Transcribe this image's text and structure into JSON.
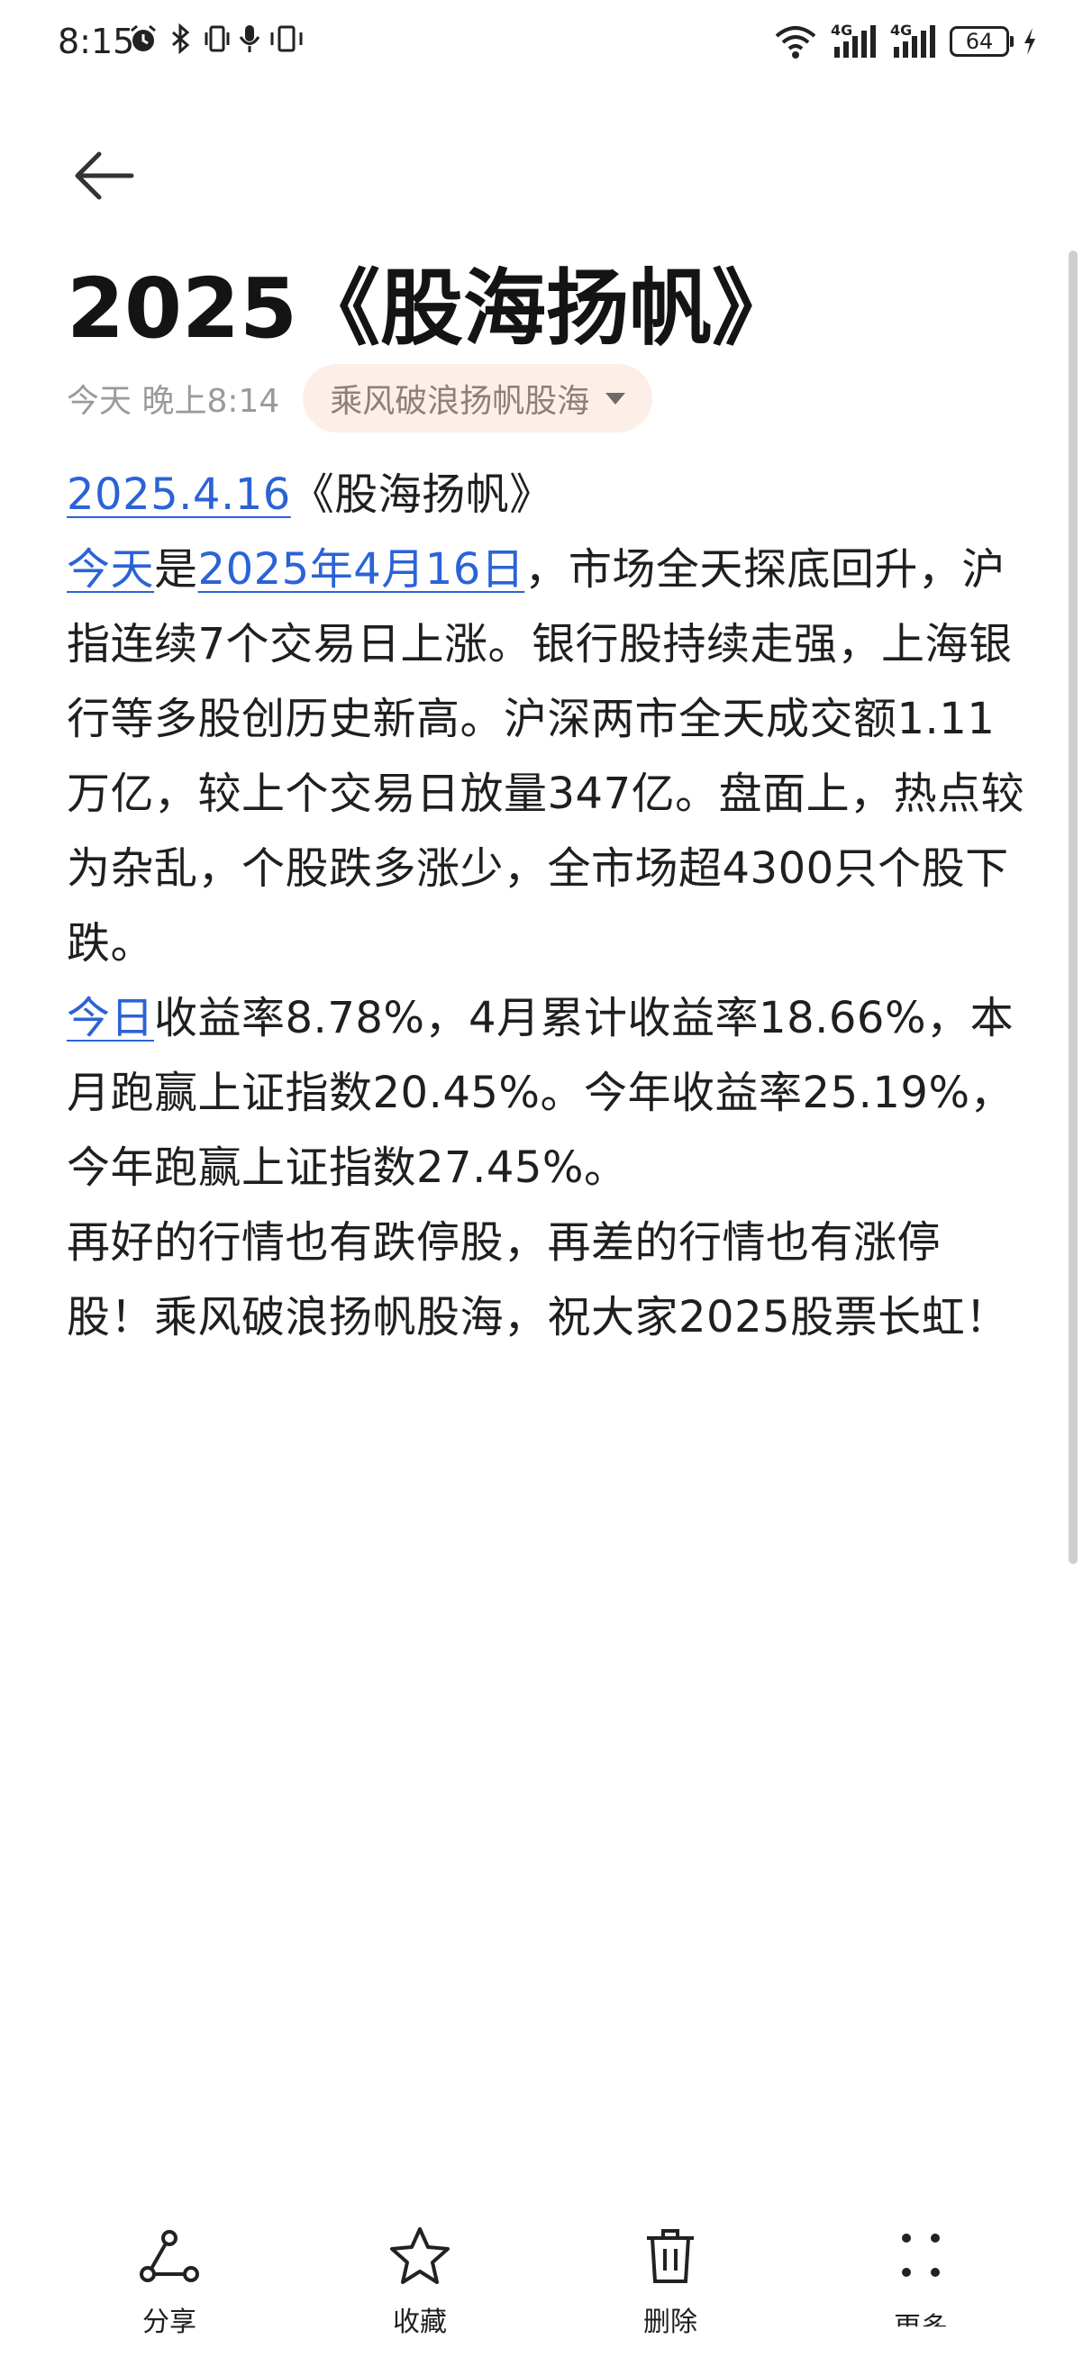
{
  "status_bar": {
    "time": "8:15",
    "battery": "64",
    "network_label_1": "4G",
    "network_label_2": "4G"
  },
  "note": {
    "title": "2025《股海扬帆》",
    "time": "今天 晚上8:14",
    "folder": "乘风破浪扬帆股海",
    "paragraphs": [
      {
        "link": "2025.4.16",
        "text": "《股海扬帆》"
      },
      {
        "link": "今天",
        "mid": "是",
        "link2": "2025年4月16日",
        "text": "，市场全天探底回升，沪指连续7个交易日上涨。银行股持续走强，上海银行等多股创历史新高。沪深两市全天成交额1.11万亿，较上个交易日放量347亿。盘面上，热点较为杂乱，个股跌多涨少，全市场超4300只个股下跌。"
      },
      {
        "link": "今日",
        "text": "收益率8.78%，4月累计收益率18.66%，本月跑赢上证指数20.45%。今年收益率25.19%，今年跑赢上证指数27.45%。"
      },
      {
        "text": "再好的行情也有跌停股，再差的行情也有涨停股！乘风破浪扬帆股海，祝大家2025股票长虹！"
      }
    ]
  },
  "toolbar": {
    "share": "分享",
    "favorite": "收藏",
    "delete": "删除",
    "more": "更多"
  },
  "colors": {
    "link": "#2b63d6",
    "chip_bg": "#fcefe8"
  }
}
